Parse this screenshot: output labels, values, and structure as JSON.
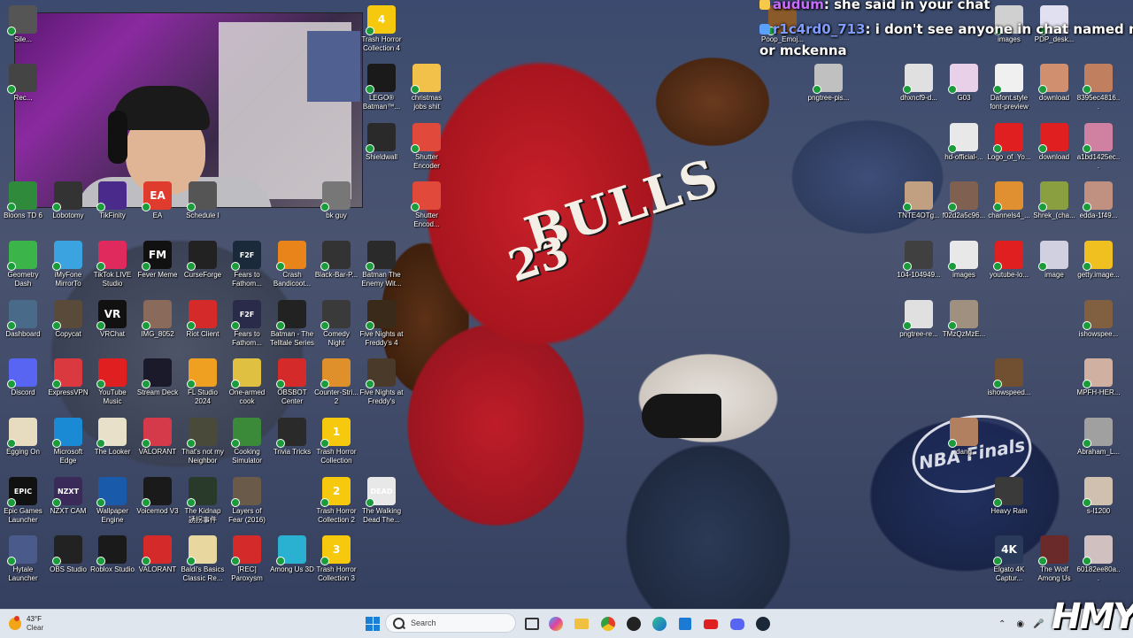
{
  "chat": [
    {
      "user": "audum",
      "message": "she said in your chat"
    },
    {
      "user": "r1c4rd0_713",
      "message": "i don't see anyone in chat named no",
      "continuation": "or mckenna"
    }
  ],
  "wallpaper": {
    "jersey_text": "BULLS",
    "jersey_number": "23",
    "logo_text": "NBA Finals"
  },
  "desktop_icons": [
    {
      "label": "Sile...",
      "color": "#555"
    },
    {
      "label": "Rec...",
      "color": "#444"
    },
    {
      "label": "Bloons TD 6",
      "color": "#2f8a3c"
    },
    {
      "label": "Lobotomy",
      "color": "#333"
    },
    {
      "label": "TikFinity",
      "color": "#4a2a8a"
    },
    {
      "label": "EA",
      "color": "#e03c2e"
    },
    {
      "label": "Schedule I",
      "color": "#555"
    },
    {
      "label": "bk guy",
      "color": "#777"
    },
    {
      "label": "Trash Horror Collection 4",
      "color": "#f6c90e"
    },
    {
      "label": "LEGO® Batman™...",
      "color": "#1a1a1a"
    },
    {
      "label": "christmas jobs shit",
      "color": "#f2c14a"
    },
    {
      "label": "Shieldwall",
      "color": "#2a2a2a"
    },
    {
      "label": "Shutter Encoder",
      "color": "#e14a3a"
    },
    {
      "label": "Shutter Encod...",
      "color": "#e14a3a"
    },
    {
      "label": "Geometry Dash",
      "color": "#3bb54a"
    },
    {
      "label": "iMyFone MirrorTo",
      "color": "#3aa3e0"
    },
    {
      "label": "TikTok LIVE Studio",
      "color": "#e02a5e"
    },
    {
      "label": "Fever Meme",
      "color": "#111"
    },
    {
      "label": "CurseForge",
      "color": "#222"
    },
    {
      "label": "Fears to Fathom...",
      "color": "#1a2a3a"
    },
    {
      "label": "Crash Bandicoot...",
      "color": "#e8841a"
    },
    {
      "label": "Black-Bar-P...",
      "color": "#333"
    },
    {
      "label": "Batman The Enemy Wit...",
      "color": "#2a2a2a"
    },
    {
      "label": "Dashboard",
      "color": "#4a6a8a"
    },
    {
      "label": "Copycat",
      "color": "#5a4a3a"
    },
    {
      "label": "VRChat",
      "color": "#111"
    },
    {
      "label": "IMG_8052",
      "color": "#8a6a5a"
    },
    {
      "label": "Riot Client",
      "color": "#d42a2a"
    },
    {
      "label": "Fears to Fathom...",
      "color": "#2a2a4a"
    },
    {
      "label": "Batman - The Telltale Series",
      "color": "#222"
    },
    {
      "label": "Comedy Night",
      "color": "#3a3a3a"
    },
    {
      "label": "Five Nights at Freddy's 4",
      "color": "#3a2a1a"
    },
    {
      "label": "Discord",
      "color": "#5865f2"
    },
    {
      "label": "ExpressVPN",
      "color": "#da3940"
    },
    {
      "label": "YouTube Music",
      "color": "#e02020"
    },
    {
      "label": "Stream Deck",
      "color": "#1a1a2a"
    },
    {
      "label": "FL Studio 2024",
      "color": "#f0a020"
    },
    {
      "label": "One-armed cook",
      "color": "#e0c040"
    },
    {
      "label": "OBSBOT Center",
      "color": "#d42a2a"
    },
    {
      "label": "Counter-Stri... 2",
      "color": "#e0902a"
    },
    {
      "label": "Five Nights at Freddy's",
      "color": "#4a3a2a"
    },
    {
      "label": "Egging On",
      "color": "#e8dcc0"
    },
    {
      "label": "Microsoft Edge",
      "color": "#1a8ad4"
    },
    {
      "label": "The Looker",
      "color": "#e8e0c8"
    },
    {
      "label": "VALORANT",
      "color": "#d43a4a"
    },
    {
      "label": "That's not my Neighbor",
      "color": "#4a4a3a"
    },
    {
      "label": "Cooking Simulator",
      "color": "#3a8a3a"
    },
    {
      "label": "Trivia Tricks",
      "color": "#2a2a2a"
    },
    {
      "label": "Trash Horror Collection",
      "color": "#f6c90e"
    },
    {
      "label": "Epic Games Launcher",
      "color": "#111"
    },
    {
      "label": "NZXT CAM",
      "color": "#3a2a5a"
    },
    {
      "label": "Wallpaper Engine",
      "color": "#1a5aaa"
    },
    {
      "label": "Voicemod V3",
      "color": "#1a1a1a"
    },
    {
      "label": "The Kidnap 誘拐事件",
      "color": "#2a3a2a"
    },
    {
      "label": "Layers of Fear (2016)",
      "color": "#6a5a4a"
    },
    {
      "label": "Trash Horror Collection 2",
      "color": "#f6c90e"
    },
    {
      "label": "The Walking Dead The...",
      "color": "#e8e8e8"
    },
    {
      "label": "Hytale Launcher",
      "color": "#4a5a8a"
    },
    {
      "label": "OBS Studio",
      "color": "#222"
    },
    {
      "label": "Roblox Studio",
      "color": "#1a1a1a"
    },
    {
      "label": "VALORANT",
      "color": "#d42a2a"
    },
    {
      "label": "Baldi's Basics Classic Re...",
      "color": "#e8d8a0"
    },
    {
      "label": "[REC] Paroxysm",
      "color": "#d42a2a"
    },
    {
      "label": "Among Us 3D",
      "color": "#2ab0d0"
    },
    {
      "label": "Trash Horror Collection 3",
      "color": "#f6c90e"
    },
    {
      "label": "images",
      "color": "#d0d0d0"
    },
    {
      "label": "PDP_desk...",
      "color": "#e0e0f0"
    },
    {
      "label": "Poop_Emoj...",
      "color": "#8a5a2a"
    },
    {
      "label": "pngtree-pis...",
      "color": "#c0c0c0"
    },
    {
      "label": "dhxncf9-d...",
      "color": "#e0e0e0"
    },
    {
      "label": "G03",
      "color": "#e8d0e8"
    },
    {
      "label": "Dafont.style font-preview",
      "color": "#f0f0f0"
    },
    {
      "label": "download",
      "color": "#d09070"
    },
    {
      "label": "8395ec4816...",
      "color": "#c08060"
    },
    {
      "label": "hd-official-...",
      "color": "#e8e8e8"
    },
    {
      "label": "Logo_of_Yo...",
      "color": "#e02020"
    },
    {
      "label": "download",
      "color": "#e02020"
    },
    {
      "label": "a1bd1425ec...",
      "color": "#d080a0"
    },
    {
      "label": "TNTE4OTg...",
      "color": "#c0a080"
    },
    {
      "label": "f02d2a5c96...",
      "color": "#806050"
    },
    {
      "label": "channels4_...",
      "color": "#e09030"
    },
    {
      "label": "Shrek_(cha...",
      "color": "#8aa040"
    },
    {
      "label": "edda-1f49...",
      "color": "#c09080"
    },
    {
      "label": "104-104949...",
      "color": "#404040"
    },
    {
      "label": "images",
      "color": "#e8e8e8"
    },
    {
      "label": "youtube-lo...",
      "color": "#e02020"
    },
    {
      "label": "image",
      "color": "#d0d0e0"
    },
    {
      "label": "getty.image...",
      "color": "#f0c020"
    },
    {
      "label": "pngtree-re...",
      "color": "#e0e0e0"
    },
    {
      "label": "TMzQzMzE...",
      "color": "#a09080"
    },
    {
      "label": "ishowspee...",
      "color": "#806040"
    },
    {
      "label": "ishowspeed...",
      "color": "#705030"
    },
    {
      "label": "MPFH-HER...",
      "color": "#d0b0a0"
    },
    {
      "label": "dang",
      "color": "#b08060"
    },
    {
      "label": "Abraham_L...",
      "color": "#a0a0a0"
    },
    {
      "label": "Heavy Rain",
      "color": "#3a3a3a"
    },
    {
      "label": "s-l1200",
      "color": "#d0c0b0"
    },
    {
      "label": "Elgato 4K Captur...",
      "color": "#2a3a5a"
    },
    {
      "label": "The Wolf Among Us",
      "color": "#6a2a2a"
    },
    {
      "label": "60182ee80a...",
      "color": "#d0c0c0"
    }
  ],
  "icon_glyphs": {
    "Trash Horror Collection 4": "4",
    "Trash Horror Collection": "1",
    "Trash Horror Collection 2": "2",
    "Trash Horror Collection 3": "3",
    "Fever Meme": "FM",
    "Fears to Fathom...": "F2F",
    "VRChat": "VR",
    "EA": "EA",
    "NZXT CAM": "NZXT",
    "Epic Games Launcher": "EPIC",
    "Elgato 4K Captur...": "4K",
    "The Walking Dead The...": "DEAD"
  },
  "taskbar": {
    "weather_temp": "43°F",
    "weather_condition": "Clear",
    "search_placeholder": "Search",
    "apps": [
      "file-explorer",
      "task-view",
      "copilot",
      "folder",
      "chrome",
      "obs",
      "edge",
      "store",
      "youtube",
      "discord",
      "steam"
    ]
  },
  "watermark": "HMY"
}
